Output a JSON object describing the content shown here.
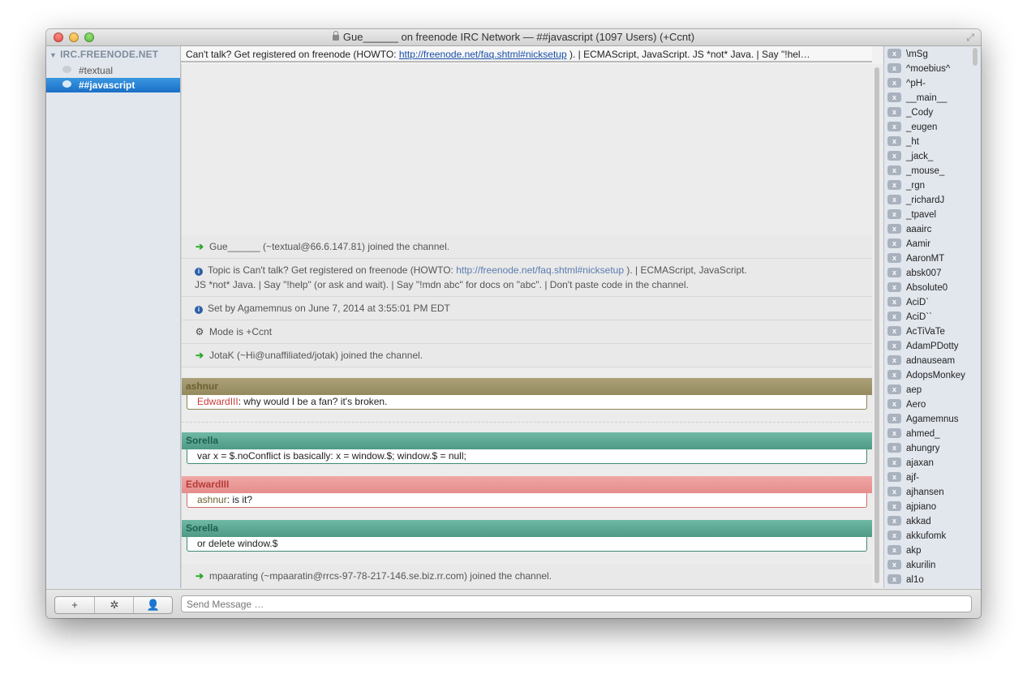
{
  "window": {
    "title": "Gue______ on freenode IRC Network — ##javascript (1097 Users) (+Ccnt)"
  },
  "icons": {
    "close": "close-dot-icon",
    "minimize": "minimize-dot-icon",
    "maximize": "maximize-dot-icon",
    "lock": "lock-icon",
    "fullscreen": "fullscreen-icon",
    "join": "arrow-right-icon",
    "info": "info-icon",
    "mode": "gears-icon",
    "add": "plus-icon",
    "settings": "gear-icon",
    "user": "person-icon"
  },
  "sidebar": {
    "server": "IRC.FREENODE.NET",
    "channels": [
      {
        "label": "#textual"
      },
      {
        "label": "##javascript"
      }
    ]
  },
  "topic": {
    "prefix": "Can't talk? Get registered on freenode (HOWTO: ",
    "link": "http://freenode.net/faq.shtml#nicksetup",
    "suffix": " ). | ECMAScript, JavaScript. JS *not* Java. | Say \"!hel…"
  },
  "events": {
    "join1": "Gue______ (~textual@66.6.147.81) joined the channel.",
    "topic_prefix": "Topic is Can't talk? Get registered on freenode (HOWTO: ",
    "topic_link": "http://freenode.net/faq.shtml#nicksetup",
    "topic_suffix": " ). | ECMAScript, JavaScript.",
    "topic_line2": "JS *not* Java. | Say \"!help\" (or ask and wait). | Say \"!mdn abc\" for docs on \"abc\". | Don't paste code in the channel.",
    "setby": "Set by Agamemnus on June 7, 2014 at 3:55:01 PM EDT",
    "mode": "Mode is +Ccnt",
    "join2": "JotaK (~Hi@unaffiliated/jotak) joined the channel.",
    "join3": "mpaarating (~mpaaratin@rrcs-97-78-217-146.se.biz.rr.com) joined the channel."
  },
  "messages": [
    {
      "nick": "ashnur",
      "mention": "EdwardIII",
      "text": ": why would I be a fan? it's broken."
    },
    {
      "nick": "Sorella",
      "mention": "",
      "text": "var x = $.noConflict is basically: x = window.$; window.$ = null;"
    },
    {
      "nick": "EdwardIII",
      "mention": "ashnur",
      "text": ": is it?"
    },
    {
      "nick": "Sorella",
      "mention": "",
      "text": "or delete window.$"
    }
  ],
  "colors": {
    "ashnur": "#9e936a",
    "sorella": "#5aa894",
    "edward": "#ea9896",
    "selection": "#1f78d1",
    "join_arrow": "#25a725"
  },
  "userlist": {
    "badge": "x",
    "users": [
      "\\mSg",
      "^moebius^",
      "^pH-",
      "__main__",
      "_Cody",
      "_eugen",
      "_ht",
      "_jack_",
      "_mouse_",
      "_rgn",
      "_richardJ",
      "_tpavel",
      "aaairc",
      "Aamir",
      "AaronMT",
      "absk007",
      "Absolute0",
      "AciD`",
      "AciD``",
      "AcTiVaTe",
      "AdamPDotty",
      "adnauseam",
      "AdopsMonkey",
      "aep",
      "Aero",
      "Agamemnus",
      "ahmed_",
      "ahungry",
      "ajaxan",
      "ajf-",
      "ajhansen",
      "ajpiano",
      "akkad",
      "akkufomk",
      "akp",
      "akurilin",
      "al1o"
    ]
  },
  "bottom": {
    "add_label": "+",
    "settings_label": "✲",
    "user_label": "👤",
    "input_placeholder": "Send Message …"
  }
}
